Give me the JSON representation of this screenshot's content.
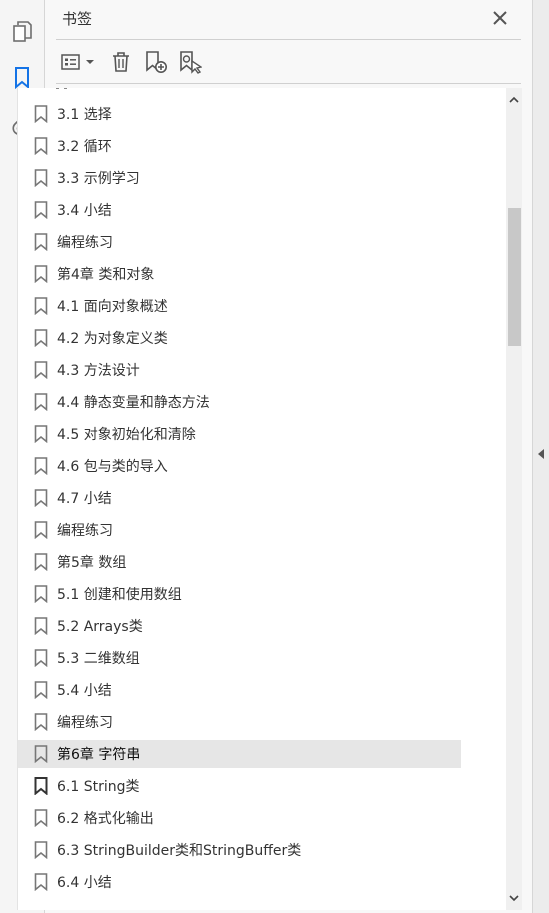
{
  "sidebar": {
    "icons": [
      "pages-icon",
      "bookmarks-icon",
      "attachments-icon"
    ]
  },
  "panel": {
    "title": "书签",
    "close_icon": "close-icon"
  },
  "toolbar": {
    "buttons": [
      "options-menu-icon",
      "delete-bookmark-icon",
      "new-bookmark-icon",
      "bookmark-from-selection-icon"
    ]
  },
  "bookmarks": [
    {
      "label": "3.1 选择"
    },
    {
      "label": "3.2 循环"
    },
    {
      "label": "3.3 示例学习"
    },
    {
      "label": "3.4 小结"
    },
    {
      "label": "编程练习"
    },
    {
      "label": "第4章 类和对象"
    },
    {
      "label": "4.1 面向对象概述"
    },
    {
      "label": "4.2 为对象定义类"
    },
    {
      "label": "4.3 方法设计"
    },
    {
      "label": "4.4 静态变量和静态方法"
    },
    {
      "label": "4.5 对象初始化和清除"
    },
    {
      "label": "4.6 包与类的导入"
    },
    {
      "label": "4.7 小结"
    },
    {
      "label": "编程练习"
    },
    {
      "label": "第5章 数组"
    },
    {
      "label": "5.1 创建和使用数组"
    },
    {
      "label": "5.2 Arrays类"
    },
    {
      "label": "5.3 二维数组"
    },
    {
      "label": "5.4 小结"
    },
    {
      "label": "编程练习"
    },
    {
      "label": "第6章 字符串",
      "selected": true
    },
    {
      "label": "6.1 String类",
      "dark": true
    },
    {
      "label": "6.2 格式化输出"
    },
    {
      "label": "6.3 StringBuilder类和StringBuffer类"
    },
    {
      "label": "6.4 小结"
    }
  ],
  "colors": {
    "accent": "#1473e6",
    "selected_bg": "#e6e6e6",
    "icon_gray": "#707070"
  }
}
